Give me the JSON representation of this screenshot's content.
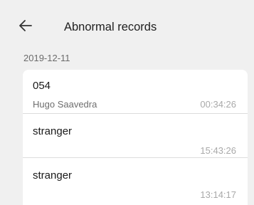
{
  "header": {
    "title": "Abnormal records",
    "back_icon": "arrow-left-icon"
  },
  "date": "2019-12-11",
  "records": [
    {
      "name": "054",
      "subtitle": "Hugo Saavedra",
      "time": "00:34:26"
    },
    {
      "name": "stranger",
      "subtitle": "",
      "time": "15:43:26"
    },
    {
      "name": "stranger",
      "subtitle": "",
      "time": "13:14:17"
    }
  ],
  "colors": {
    "background": "#f0f0f0",
    "card": "#ffffff",
    "divider": "#dcdcdc",
    "time_text": "#a9a9a9"
  }
}
